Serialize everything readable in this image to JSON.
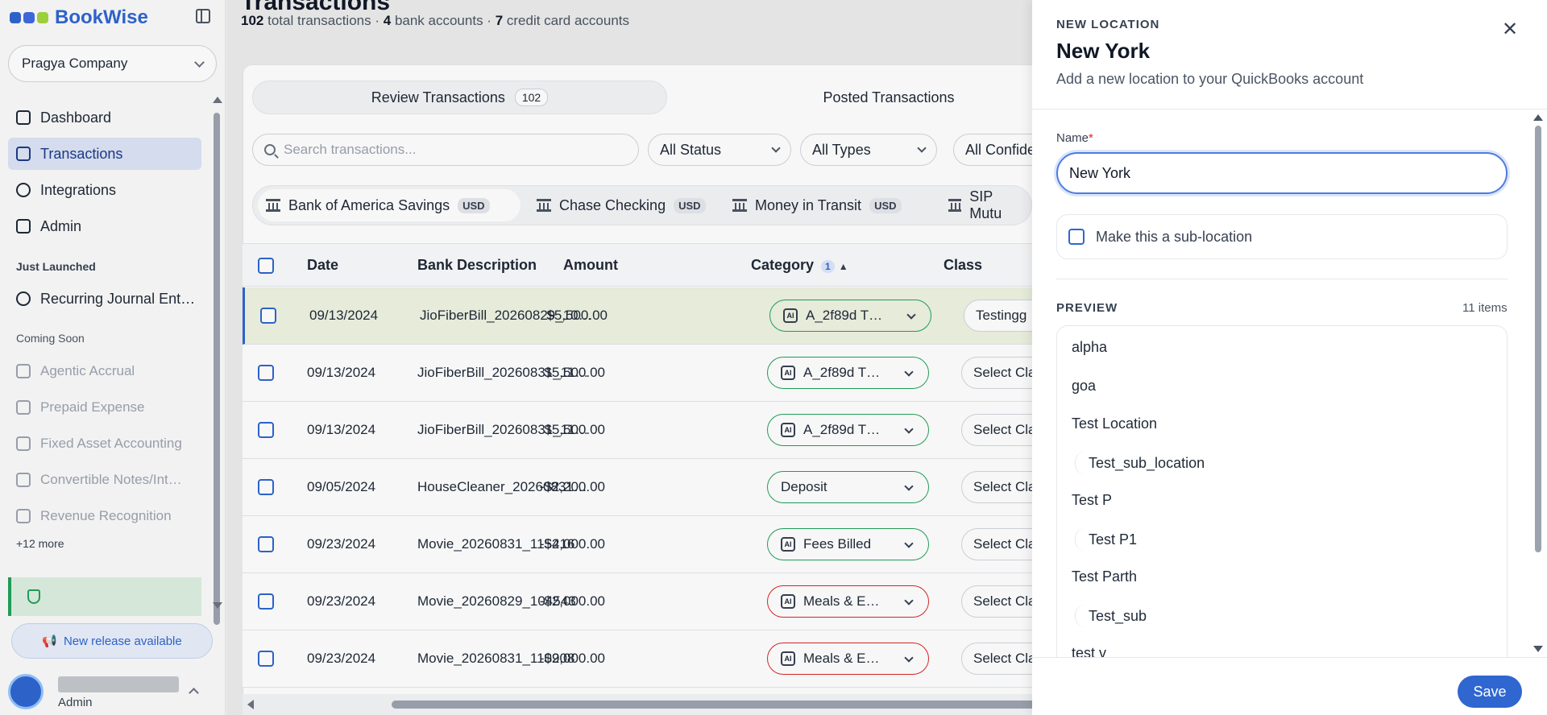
{
  "app": {
    "name": "BookWise",
    "company": "Pragya Company"
  },
  "colors": {
    "brand": "#2f66d0",
    "logo_dots": [
      "#2f66d0",
      "#4169e1",
      "#a3d63b"
    ],
    "success": "#22a05a",
    "danger": "#dc2626"
  },
  "sidebar": {
    "items": [
      {
        "label": "Dashboard",
        "icon": "dashboard-icon"
      },
      {
        "label": "Transactions",
        "icon": "transactions-icon",
        "active": true
      },
      {
        "label": "Integrations",
        "icon": "gear-icon"
      },
      {
        "label": "Admin",
        "icon": "shield-icon"
      }
    ],
    "just_launched_label": "Just Launched",
    "just_launched": [
      {
        "label": "Recurring Journal Ent…",
        "icon": "refresh-icon"
      }
    ],
    "coming_soon_label": "Coming Soon",
    "coming_soon": [
      {
        "label": "Agentic Accrual",
        "icon": "wallet-icon"
      },
      {
        "label": "Prepaid Expense",
        "icon": "card-icon"
      },
      {
        "label": "Fixed Asset Accounting",
        "icon": "box-icon"
      },
      {
        "label": "Convertible Notes/Int…",
        "icon": "trend-icon"
      },
      {
        "label": "Revenue Recognition",
        "icon": "bar-chart-icon"
      }
    ],
    "more_label": "+12 more",
    "release_label": "New release available",
    "user_role": "Admin"
  },
  "main": {
    "title": "Transactions",
    "summary": {
      "total": "102",
      "total_text": "total transactions",
      "banks": "4",
      "banks_text": "bank accounts",
      "cards": "7",
      "cards_text": "credit card accounts"
    },
    "tabs": [
      {
        "label": "Review Transactions",
        "count": "102"
      },
      {
        "label": "Posted Transactions"
      }
    ],
    "search_placeholder": "Search transactions...",
    "filters": [
      "All Status",
      "All Types",
      "All Confide"
    ],
    "banks": [
      {
        "name": "Bank of America Savings",
        "currency": "USD"
      },
      {
        "name": "Chase Checking",
        "currency": "USD"
      },
      {
        "name": "Money in Transit",
        "currency": "USD"
      },
      {
        "name": "SIP Mutu"
      }
    ],
    "columns": {
      "date": "Date",
      "desc": "Bank Description",
      "amount": "Amount",
      "category": "Category",
      "category_sort": "1",
      "class": "Class"
    },
    "rows": [
      {
        "date": "09/13/2024",
        "desc": "JioFiberBill_20260829_10…",
        "amount": "$5,500.00",
        "category": "A_2f89d T…",
        "category_state": "ok",
        "class": "Testingg"
      },
      {
        "date": "09/13/2024",
        "desc": "JioFiberBill_20260831_11…",
        "amount": "$5,500.00",
        "category": "A_2f89d T…",
        "category_state": "ok",
        "class": "Select Class"
      },
      {
        "date": "09/13/2024",
        "desc": "JioFiberBill_20260831_11…",
        "amount": "$5,500.00",
        "category": "A_2f89d T…",
        "category_state": "ok",
        "class": "Select Class"
      },
      {
        "date": "09/05/2024",
        "desc": "HouseCleaner_20260831…",
        "amount": "-$2,200.00",
        "category": "Deposit",
        "category_state": "ok",
        "class": "Select Class"
      },
      {
        "date": "09/23/2024",
        "desc": "Movie_20260831_115416",
        "amount": "-$2,000.00",
        "category": "Fees Billed",
        "category_state": "ok",
        "class": "Select Class"
      },
      {
        "date": "09/23/2024",
        "desc": "Movie_20260829_104543",
        "amount": "-$2,000.00",
        "category": "Meals & E…",
        "category_state": "error",
        "class": "Select Class"
      },
      {
        "date": "09/23/2024",
        "desc": "Movie_20260831_110908",
        "amount": "-$2,000.00",
        "category": "Meals & E…",
        "category_state": "error",
        "class": "Select Class"
      }
    ]
  },
  "drawer": {
    "kicker": "NEW LOCATION",
    "title": "New York",
    "subtitle": "Add a new location to your QuickBooks account",
    "name_label": "Name",
    "required_mark": "*",
    "name_value": "New York",
    "sublocation_label": "Make this a sub-location",
    "preview_label": "PREVIEW",
    "preview_count": "11 items",
    "preview_items": [
      {
        "label": "alpha",
        "child": false
      },
      {
        "label": "goa",
        "child": false
      },
      {
        "label": "Test Location",
        "child": false
      },
      {
        "label": "Test_sub_location",
        "child": true
      },
      {
        "label": "Test P",
        "child": false
      },
      {
        "label": "Test P1",
        "child": true
      },
      {
        "label": "Test Parth",
        "child": false
      },
      {
        "label": "Test_sub",
        "child": true
      },
      {
        "label": "test v",
        "child": false
      }
    ],
    "save_label": "Save",
    "close_icon": "close-icon"
  }
}
